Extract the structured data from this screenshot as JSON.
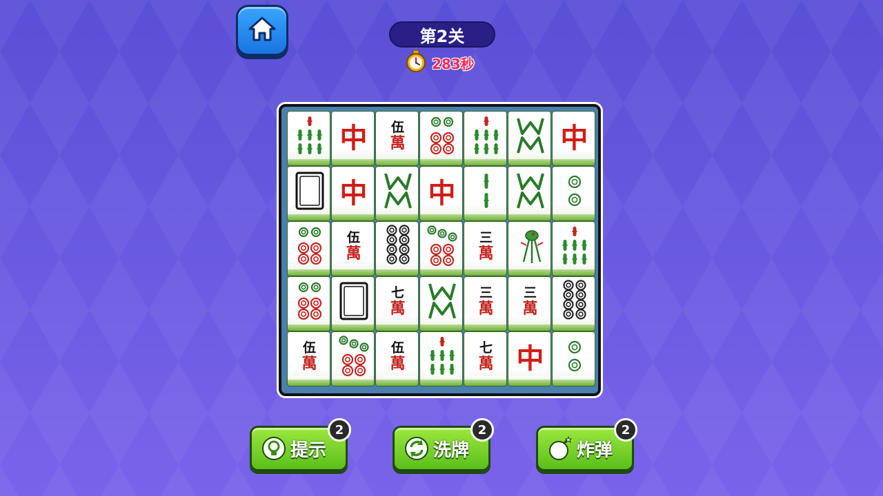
{
  "header": {
    "home_icon": "home-icon",
    "level_title": "第2关",
    "timer_icon": "stopwatch-icon",
    "timer_text": "283秒"
  },
  "board": {
    "rows": [
      [
        "bamboo-6",
        "red-dragon",
        "character-5",
        "circle-6",
        "bamboo-6",
        "bamboo-7",
        "red-dragon"
      ],
      [
        "white-dragon",
        "red-dragon",
        "bamboo-7",
        "red-dragon",
        "bamboo-2",
        "bamboo-7",
        "circle-2"
      ],
      [
        "circle-6",
        "character-5",
        "circle-8",
        "circle-7",
        "character-3",
        "bamboo-1",
        "bamboo-6"
      ],
      [
        "circle-6",
        "white-dragon",
        "character-7",
        "bamboo-7",
        "character-3",
        "character-3",
        "circle-8"
      ],
      [
        "character-5",
        "circle-7",
        "character-5",
        "bamboo-6",
        "character-7",
        "red-dragon",
        "circle-2"
      ]
    ],
    "glyphs": {
      "character-5": {
        "top": "伍",
        "bottom": "萬"
      },
      "character-3": {
        "top": "三",
        "bottom": "萬"
      },
      "character-7": {
        "top": "七",
        "bottom": "萬"
      },
      "red-dragon": {
        "text": "中"
      }
    }
  },
  "actions": [
    {
      "label": "提示",
      "count": "2",
      "icon": "lightbulb-icon"
    },
    {
      "label": "洗牌",
      "count": "2",
      "icon": "shuffle-icon"
    },
    {
      "label": "炸弹",
      "count": "2",
      "icon": "bomb-icon"
    }
  ],
  "colors": {
    "background": "#6355dd",
    "button_green": "#6fcc22",
    "timer_red": "#ff2a55",
    "board_blue": "#4a7fb0"
  }
}
